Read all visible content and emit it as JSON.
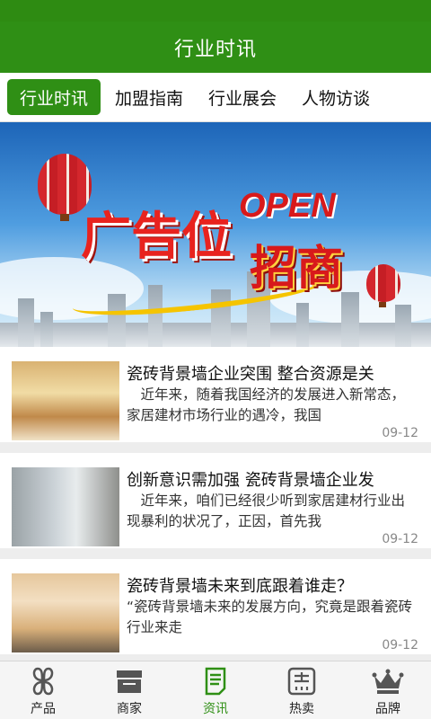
{
  "header": {
    "title": "行业时讯"
  },
  "tabs": [
    {
      "label": "行业时讯",
      "active": true
    },
    {
      "label": "加盟指南",
      "active": false
    },
    {
      "label": "行业展会",
      "active": false
    },
    {
      "label": "人物访谈",
      "active": false
    }
  ],
  "banner": {
    "text_main": "广告位",
    "text_open": "OPEN",
    "text_sub": "招商"
  },
  "articles": [
    {
      "title": "瓷砖背景墙企业突围 整合资源是关",
      "summary": "　近年来，随着我国经济的发展进入新常态，家居建材市场行业的遇冷，我国",
      "date": "09-12"
    },
    {
      "title": "创新意识需加强 瓷砖背景墙企业发",
      "summary": "　近年来，咱们已经很少听到家居建材行业出现暴利的状况了，正因，首先我",
      "date": "09-12"
    },
    {
      "title": "瓷砖背景墙未来到底跟着谁走？",
      "summary": "“瓷砖背景墙未来的发展方向，究竟是跟着瓷砖行业来走",
      "date": "09-12"
    }
  ],
  "bottom_nav": [
    {
      "label": "产品",
      "icon": "clover-icon",
      "active": false
    },
    {
      "label": "商家",
      "icon": "store-icon",
      "active": false
    },
    {
      "label": "资讯",
      "icon": "news-document-icon",
      "active": true
    },
    {
      "label": "热卖",
      "icon": "hot-sale-icon",
      "active": false
    },
    {
      "label": "品牌",
      "icon": "crown-icon",
      "active": false
    }
  ],
  "colors": {
    "primary": "#2f8f15",
    "accent_red": "#d8191b",
    "gold": "#f5c400"
  }
}
